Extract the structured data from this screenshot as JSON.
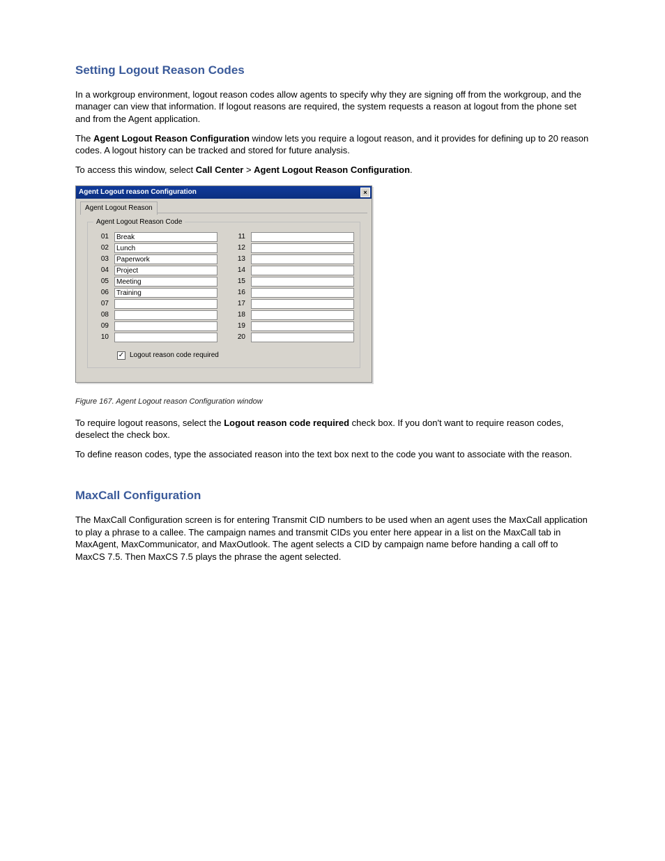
{
  "section1": {
    "heading": "Setting Logout Reason Codes",
    "p1": "In a workgroup environment, logout reason codes allow agents to specify why they are signing off from the workgroup, and the manager can view that information. If logout reasons are required, the system requests a reason at logout from the phone set and from the Agent application.",
    "p2a": "The ",
    "p2b": "Agent Logout Reason Configuration",
    "p2c": " window lets you require a logout reason, and it provides for defining up to 20 reason codes. A logout history can be tracked and stored for future analysis.",
    "p3a": "To access this window, select ",
    "p3b": "Call Center",
    "p3c": " > ",
    "p3d": "Agent Logout Reason Configuration",
    "p3e": "."
  },
  "dialog": {
    "title": "Agent Logout reason Configuration",
    "tab": "Agent Logout Reason",
    "legend": "Agent Logout Reason Code",
    "left": [
      {
        "num": "01",
        "val": "Break"
      },
      {
        "num": "02",
        "val": "Lunch"
      },
      {
        "num": "03",
        "val": "Paperwork"
      },
      {
        "num": "04",
        "val": "Project"
      },
      {
        "num": "05",
        "val": "Meeting"
      },
      {
        "num": "06",
        "val": "Training"
      },
      {
        "num": "07",
        "val": ""
      },
      {
        "num": "08",
        "val": ""
      },
      {
        "num": "09",
        "val": ""
      },
      {
        "num": "10",
        "val": ""
      }
    ],
    "right": [
      {
        "num": "11",
        "val": ""
      },
      {
        "num": "12",
        "val": ""
      },
      {
        "num": "13",
        "val": ""
      },
      {
        "num": "14",
        "val": ""
      },
      {
        "num": "15",
        "val": ""
      },
      {
        "num": "16",
        "val": ""
      },
      {
        "num": "17",
        "val": ""
      },
      {
        "num": "18",
        "val": ""
      },
      {
        "num": "19",
        "val": ""
      },
      {
        "num": "20",
        "val": ""
      }
    ],
    "checkbox": {
      "checked": true,
      "label": "Logout reason code required"
    }
  },
  "figure": {
    "label": "Figure 167. Agent Logout reason Configuration window"
  },
  "after": {
    "p1a": "To require logout reasons, select the ",
    "p1b": "Logout reason code required",
    "p1c": " check box. If you don't want to require reason codes, deselect the check box.",
    "p2": "To define reason codes, type the associated reason into the text box next to the code you want to associate with the reason."
  },
  "section2": {
    "heading": "MaxCall Configuration",
    "p1": "The MaxCall Configuration screen is for entering Transmit CID numbers to be used when an agent uses the MaxCall application to play a phrase to a callee. The campaign names and transmit CIDs you enter here appear in a list on the MaxCall tab in MaxAgent, MaxCommunicator, and MaxOutlook. The agent selects a CID by campaign name before handing a call off to MaxCS 7.5. Then MaxCS 7.5 plays the phrase the agent selected."
  }
}
